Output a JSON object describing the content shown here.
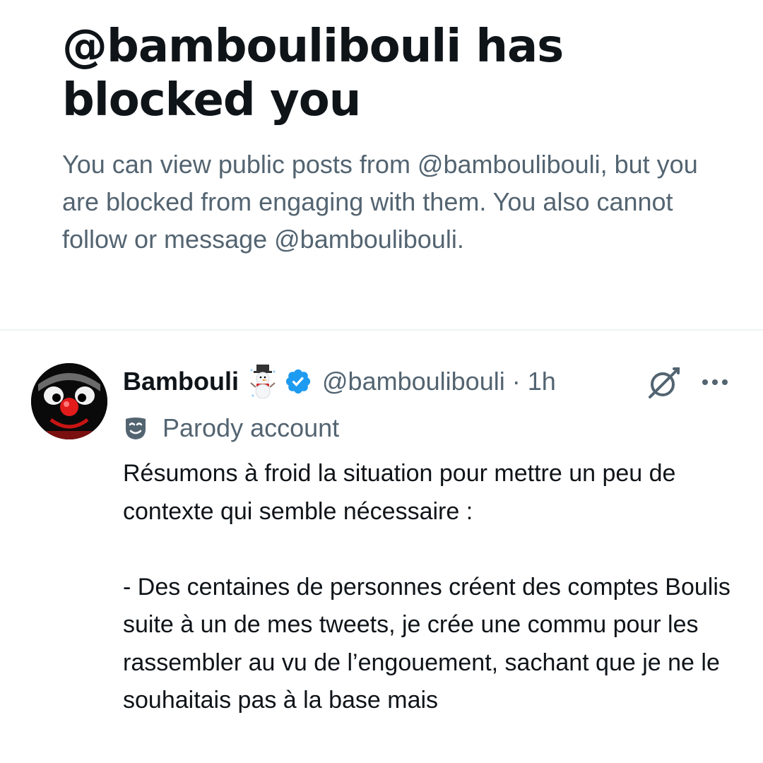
{
  "blocked": {
    "title": "@bamboulibouli has blocked you",
    "description": "You can view public posts from @bamboulibouli, but you are blocked from engaging with them. You also cannot follow or message @bamboulibouli."
  },
  "post": {
    "author_name": "Bambouli",
    "author_handle": "@bamboulibouli",
    "separator": "·",
    "time": "1h",
    "label": "Parody account",
    "text": "Résumons à froid la situation pour mettre un peu de contexte qui semble nécessaire :\n\n- Des centaines de personnes créent des comptes Boulis suite à un de mes tweets, je crée une commu pour les rassembler au vu de l’engouement, sachant que je ne le souhaitais pas à la base mais"
  },
  "icons": {
    "name_badge": "snowman-emoji-icon",
    "verified": "verified-badge-icon",
    "grok": "grok-icon",
    "more": "more-options-icon",
    "parody": "theater-mask-icon"
  },
  "colors": {
    "text_primary": "#0f1419",
    "text_secondary": "#536471",
    "verified_blue": "#1d9bf0",
    "divider": "#eff3f4"
  }
}
